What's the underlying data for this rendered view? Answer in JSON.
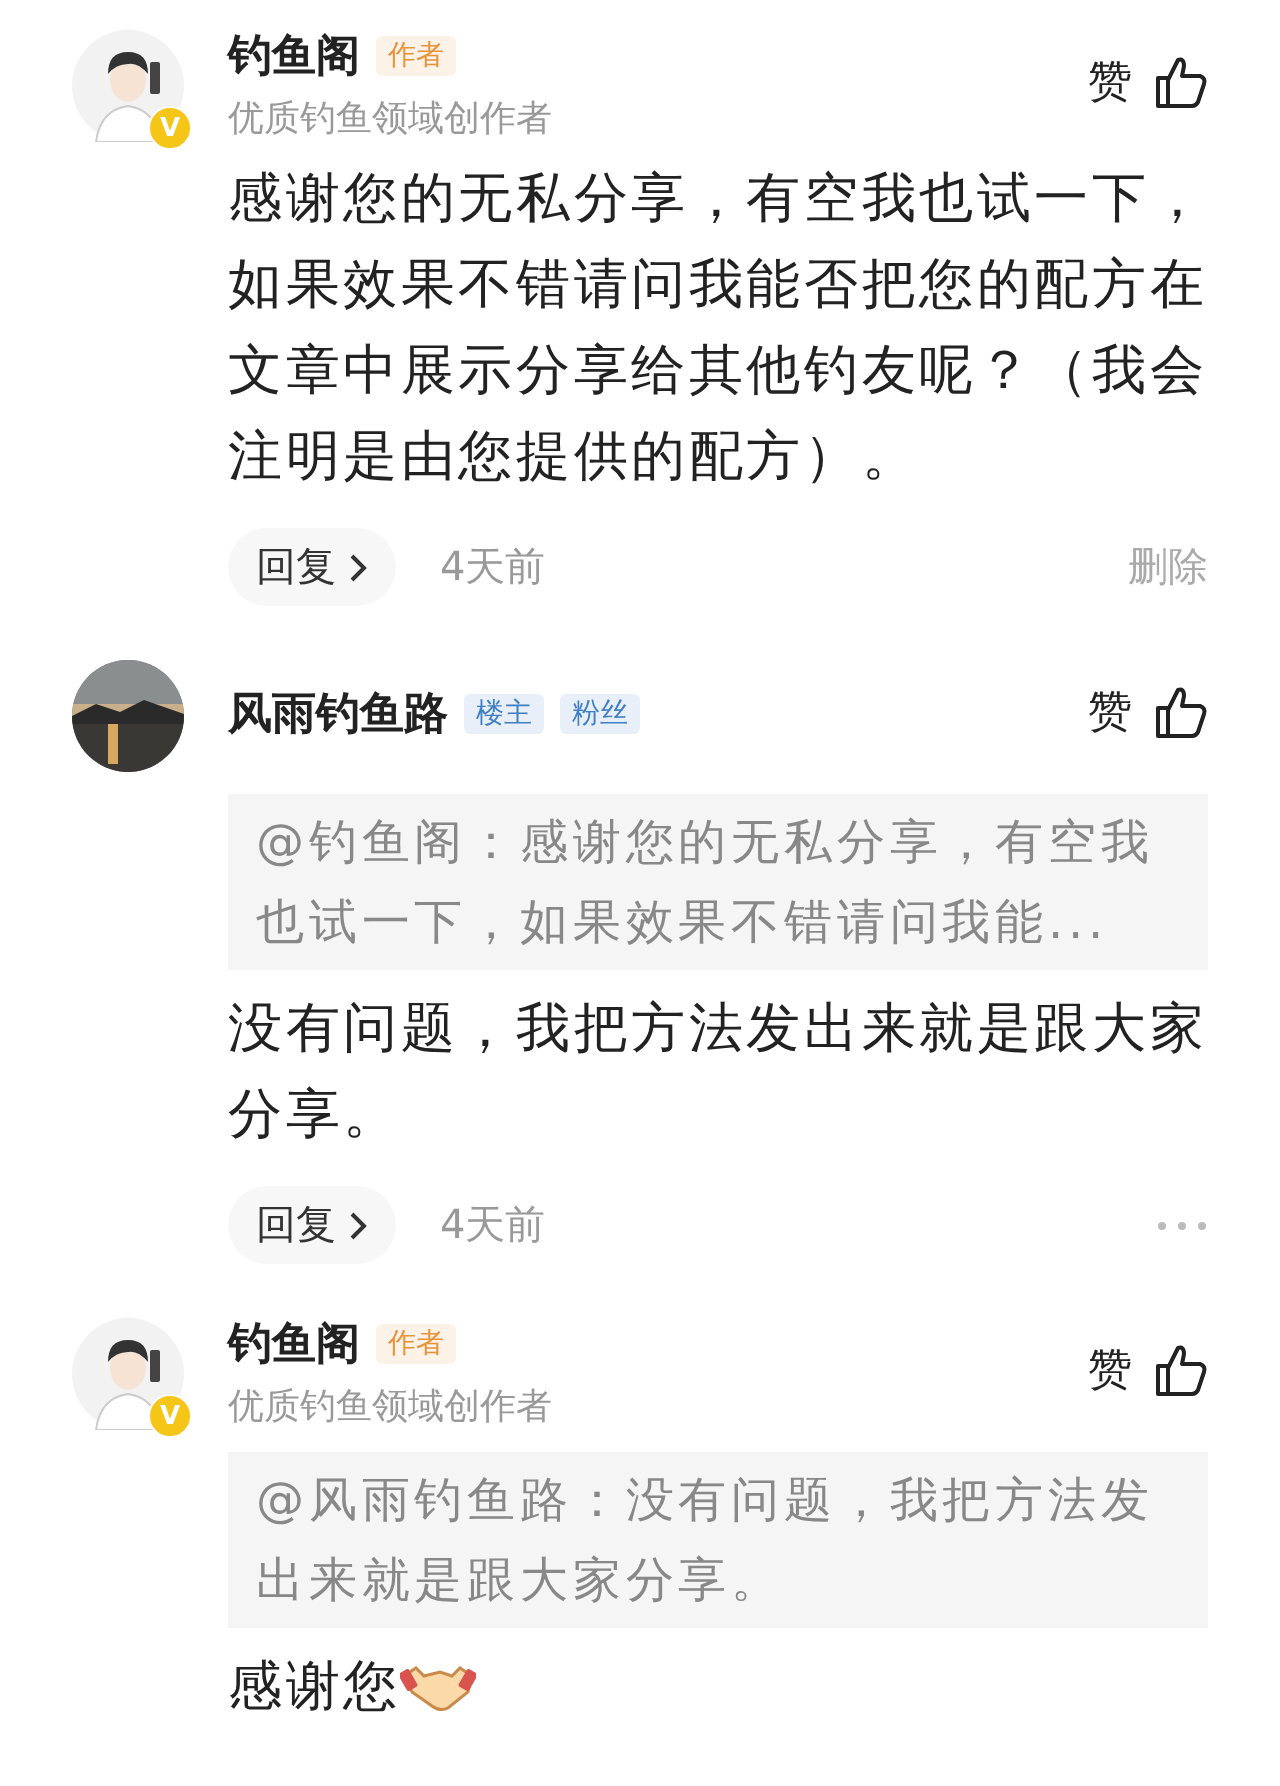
{
  "comments": [
    {
      "avatar": {
        "kind": "cartoon",
        "badge": "V"
      },
      "name": "钓鱼阁",
      "badges": [
        {
          "label": "作者",
          "color": "#e8923a"
        }
      ],
      "subtitle": "优质钓鱼领域创作者",
      "like": "赞",
      "text": "感谢您的无私分享，有空我也试一下，如果效果不错请问我能否把您的配方在文章中展示分享给其他钓友呢？（我会注明是由您提供的配方）。",
      "emoji": false,
      "reply": "回复",
      "time": "4天前",
      "action": {
        "kind": "text",
        "label": "删除"
      }
    },
    {
      "avatar": {
        "kind": "picture"
      },
      "name": "风雨钓鱼路",
      "badges": [
        {
          "label": "楼主",
          "color": "#3f7fc4"
        },
        {
          "label": "粉丝",
          "color": "#3f7fc4"
        }
      ],
      "like": "赞",
      "quote": "@钓鱼阁：感谢您的无私分享，有空我也试一下，如果效果不错请问我能...",
      "text": "没有问题，我把方法发出来就是跟大家分享。",
      "emoji": false,
      "reply": "回复",
      "time": "4天前",
      "action": {
        "kind": "more"
      }
    },
    {
      "avatar": {
        "kind": "cartoon",
        "badge": "V"
      },
      "name": "钓鱼阁",
      "badges": [
        {
          "label": "作者",
          "color": "#e8923a"
        }
      ],
      "subtitle": "优质钓鱼领域创作者",
      "like": "赞",
      "quote": "@风雨钓鱼路：没有问题，我把方法发出来就是跟大家分享。",
      "text": "感谢您",
      "emoji": true
    }
  ]
}
